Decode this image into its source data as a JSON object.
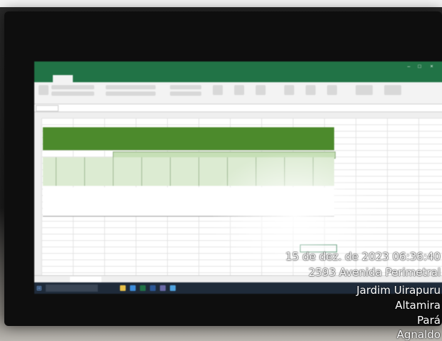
{
  "photo": {
    "subject": "computer monitor displaying a spreadsheet",
    "colors": {
      "excel_green": "#217346",
      "table_green": "#4c8a2c",
      "header_light_green": "#dcebd2",
      "stamp_text": "#ffffff"
    }
  },
  "timestamp_overlay": {
    "line1": "15 de dez. de 2023 06:36:40",
    "line2": "2593 Avenida Perimetral",
    "line3": "Jardim Uirapuru",
    "line4": "Altamira",
    "line5": "Pará",
    "line6": "Agnaldo"
  },
  "icons": [
    "windows-start-icon",
    "close-icon",
    "minimize-icon",
    "maximize-icon"
  ]
}
